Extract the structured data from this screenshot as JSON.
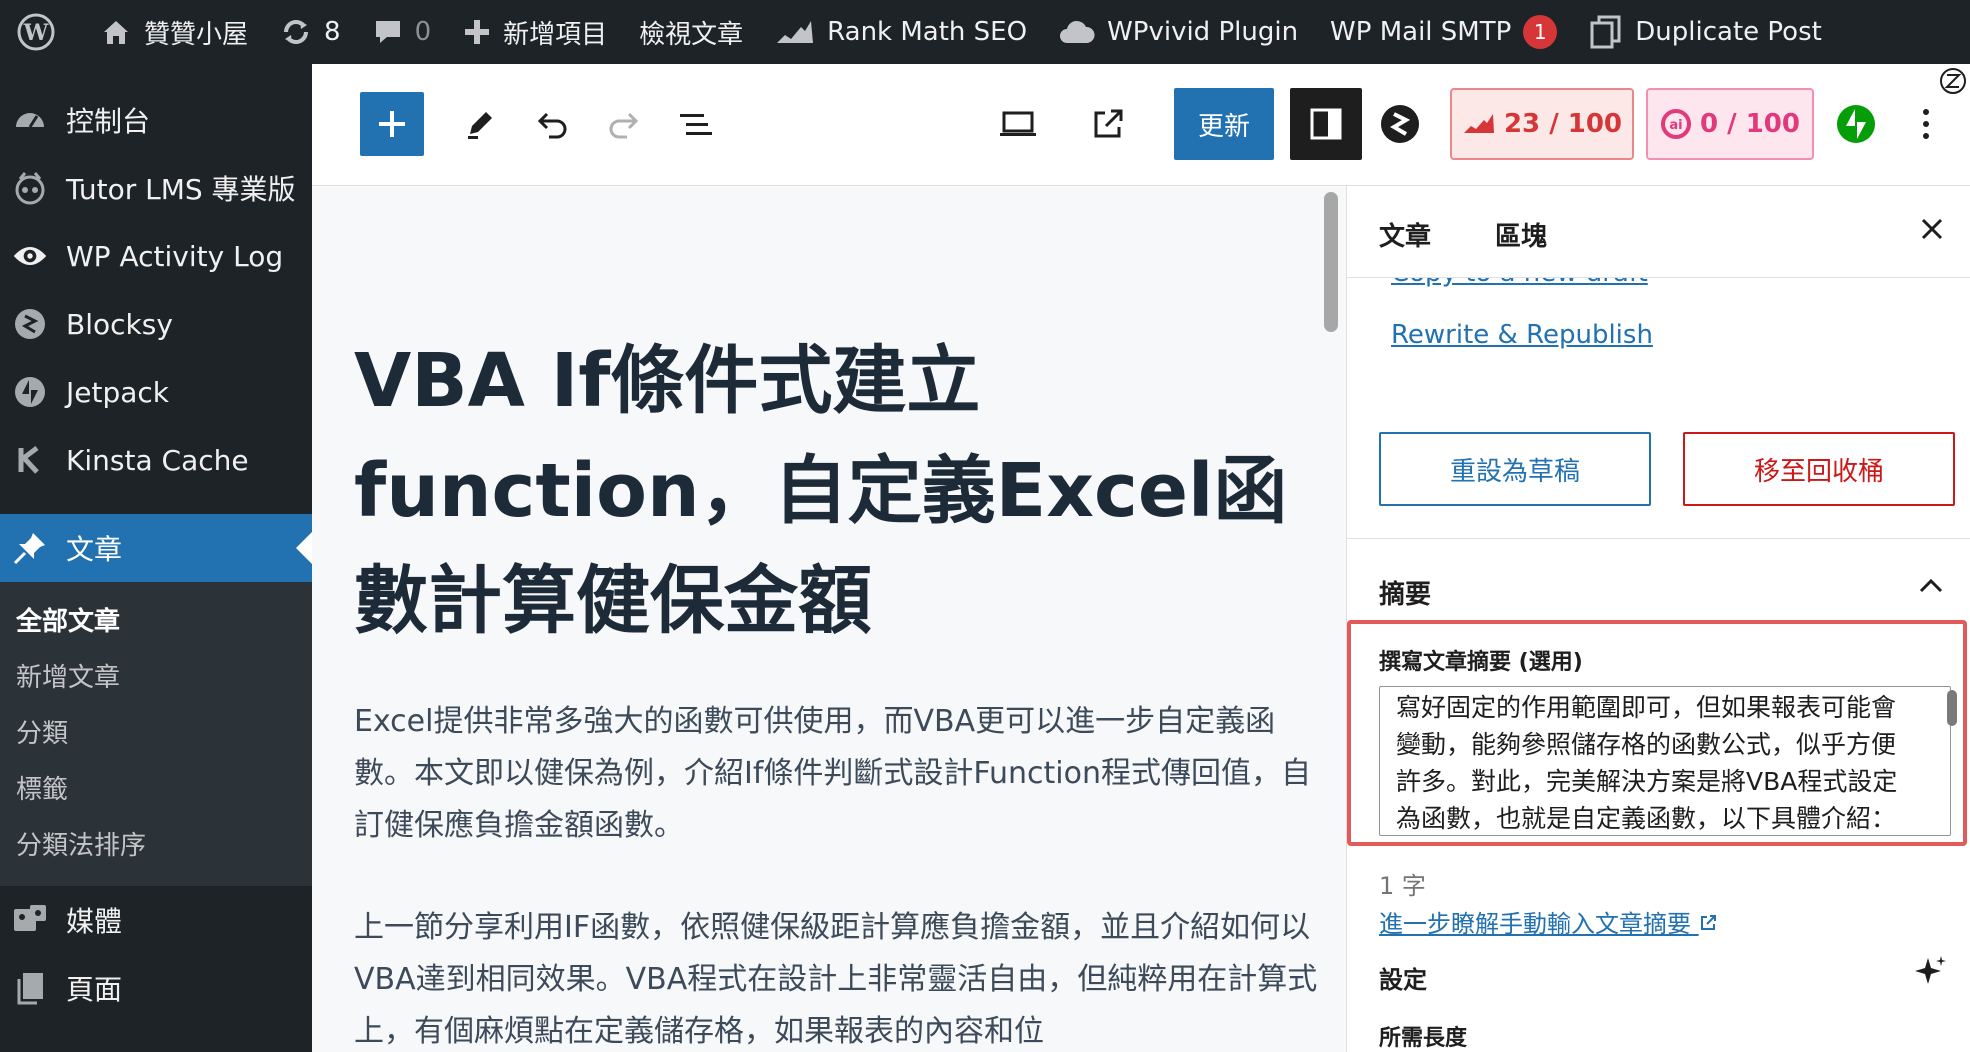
{
  "admin_bar": {
    "site_name": "贊贊小屋",
    "updates_count": "8",
    "comments_count": "0",
    "new_item": "新增項目",
    "view_post": "檢視文章",
    "rank_math": "Rank Math SEO",
    "wpvivid": "WPvivid Plugin",
    "wp_mail_smtp": "WP Mail SMTP",
    "smtp_badge": "1",
    "duplicate_post": "Duplicate Post"
  },
  "sidebar": {
    "items": [
      {
        "label": "控制台",
        "icon": "dashboard-icon"
      },
      {
        "label": "Tutor LMS 專業版",
        "icon": "tutor-icon"
      },
      {
        "label": "WP Activity Log",
        "icon": "eye-icon"
      },
      {
        "label": "Blocksy",
        "icon": "blocksy-icon"
      },
      {
        "label": "Jetpack",
        "icon": "jetpack-icon"
      },
      {
        "label": "Kinsta Cache",
        "icon": "kinsta-icon"
      },
      {
        "label": "文章",
        "icon": "pin-icon"
      },
      {
        "label": "媒體",
        "icon": "media-icon"
      },
      {
        "label": "頁面",
        "icon": "page-icon"
      }
    ],
    "submenu": [
      "全部文章",
      "新增文章",
      "分類",
      "標籤",
      "分類法排序"
    ]
  },
  "toolbar": {
    "update_label": "更新",
    "seo_score": "23 / 100",
    "content_score": "0 / 100"
  },
  "post": {
    "title": "VBA If條件式建立function，自定義Excel函數計算健保金額",
    "paragraph1": "Excel提供非常多強大的函數可供使用，而VBA更可以進一步自定義函數。本文即以健保為例，介紹If條件判斷式設計Function程式傳回值，自訂健保應負擔金額函數。",
    "paragraph2": "上一節分享利用IF函數，依照健保級距計算應負擔金額，並且介紹如何以VBA達到相同效果。VBA程式在設計上非常靈活自由，但純粹用在計算式上，有個麻煩點在定義儲存格，如果報表的內容和位"
  },
  "panel": {
    "tab_post": "文章",
    "tab_block": "區塊",
    "copy_link": "Copy to a new draft",
    "rewrite_link": "Rewrite & Republish",
    "reset_draft": "重設為草稿",
    "move_trash": "移至回收桶",
    "excerpt_title": "摘要",
    "excerpt_label": "撰寫文章摘要 (選用)",
    "excerpt_value": "寫好固定的作用範圍即可，但如果報表可能會變動，能夠參照儲存格的函數公式，似乎方便許多。對此，完美解決方案是將VBA程式設定為函數，也就是自定義函數，以下具體介紹：",
    "word_count": "1 字",
    "learn_more": "進一步瞭解手動輸入文章摘要",
    "settings_title": "設定",
    "length_label": "所需長度"
  },
  "colors": {
    "admin_dark": "#1d2327",
    "accent": "#2271b1",
    "danger": "#cc1818",
    "highlight": "#e25a5a"
  }
}
